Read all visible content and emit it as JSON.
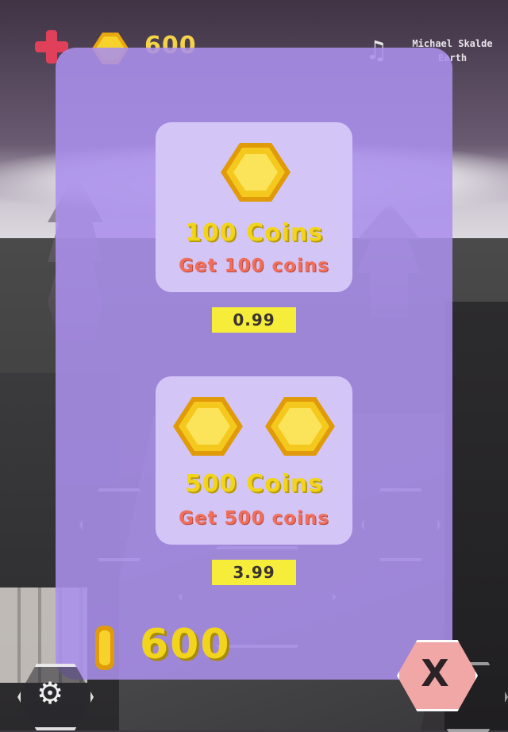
{
  "hud": {
    "score": "600",
    "artist": "Michael Skalde",
    "track_location": "Earth",
    "health_icon": "plus-icon",
    "coin_icon": "coin-icon",
    "music_icon": "music-note-icon"
  },
  "shop": {
    "products": [
      {
        "title": "100 Coins",
        "subtitle": "Get 100 coins",
        "price": "0.99",
        "coin_count": 1
      },
      {
        "title": "500 Coins",
        "subtitle": "Get 500 coins",
        "price": "3.99",
        "coin_count": 2
      }
    ],
    "balance": "600",
    "close_label": "X"
  },
  "menu": {
    "icons": [
      "stats-icon",
      "joystick-icon",
      "shop-icon",
      "gear-icon",
      "rotate-icon"
    ]
  },
  "colors": {
    "panel": "#ab8fec",
    "card": "#d3c6f7",
    "coin_gold": "#f2d41c",
    "subtitle_orange": "#f06f5c",
    "price_yellow": "#f6ec3a",
    "close_pink": "#f2a7a7"
  }
}
